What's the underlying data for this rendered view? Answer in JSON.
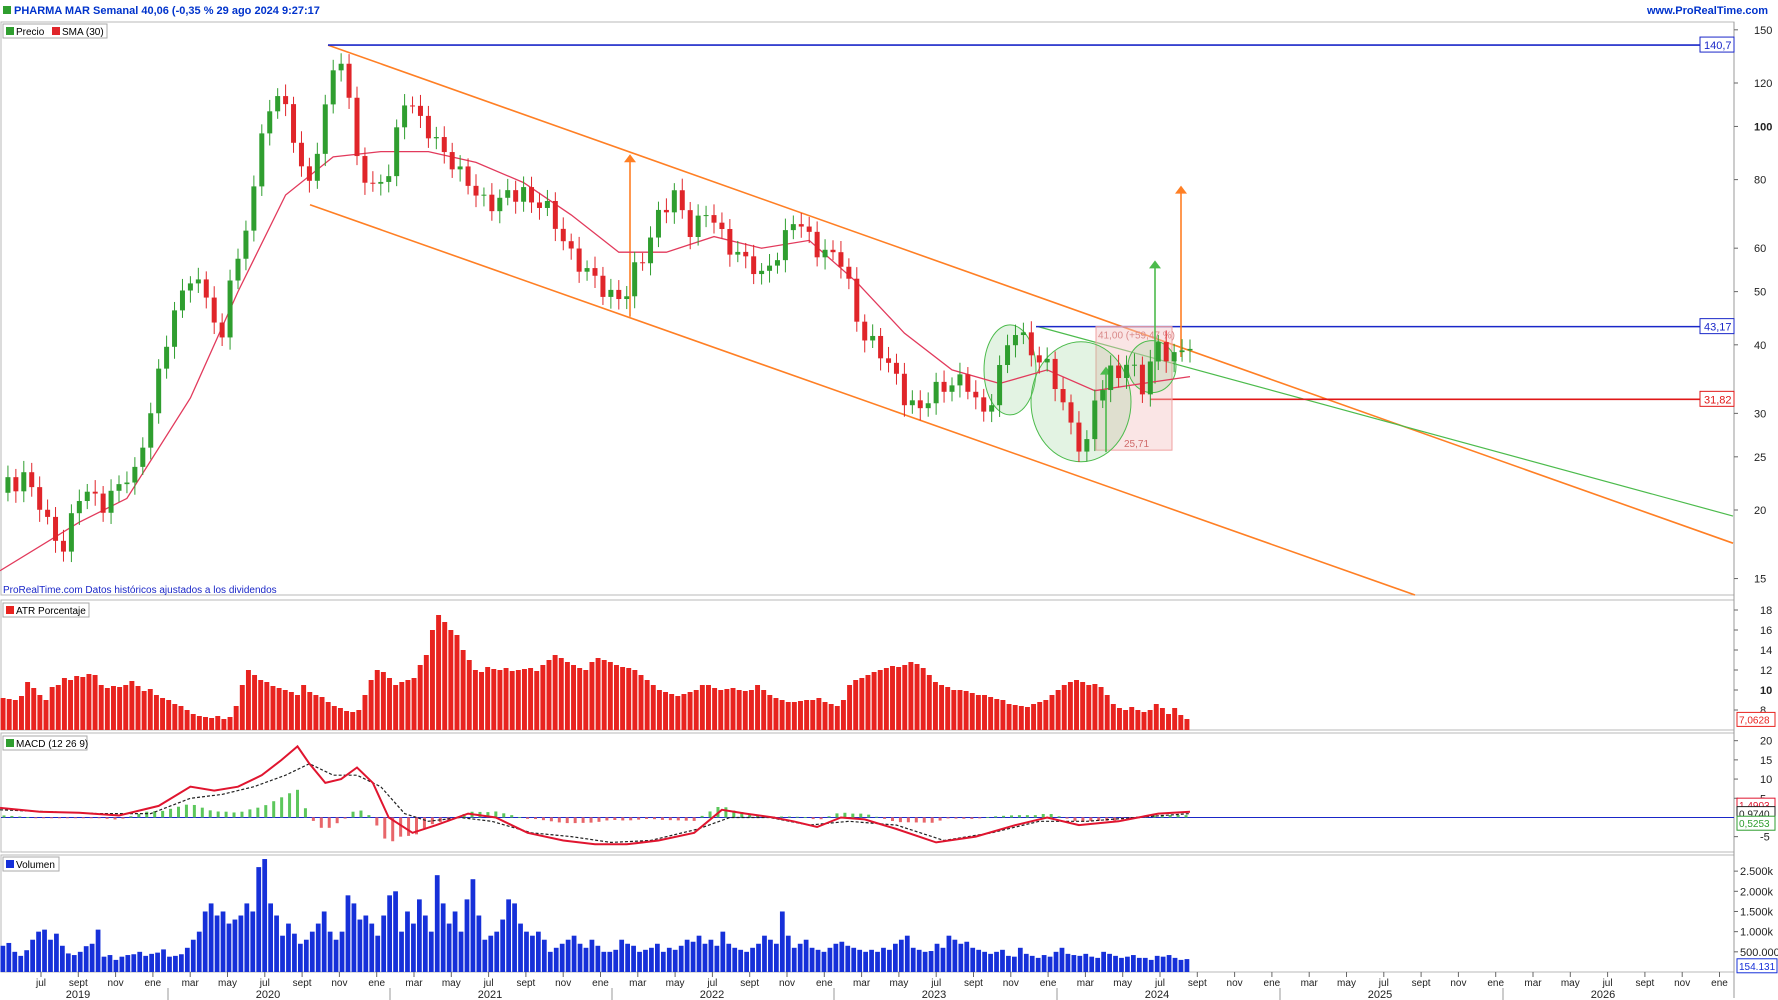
{
  "header": {
    "title": "PHARMA MAR Semanal 40,06 (-0,35 % 29 ago 2024 9:27:17",
    "brand": "www.ProRealTime.com"
  },
  "colors": {
    "up": "#2f9e2f",
    "down": "#e0252a",
    "sma": "#e23a5c",
    "channel": "#ff7f24",
    "blue_line": "#1a27c8",
    "red_line": "#e01818",
    "green_line": "#4cbb4c",
    "atr": "#e8231f",
    "macd": "#e0152f",
    "signal": "#222222",
    "volume": "#1630d9"
  },
  "chart_data": [
    {
      "type": "line",
      "panel": "price",
      "scale": "log",
      "ylim": [
        14,
        155
      ],
      "y_ticks": [
        "15",
        "20",
        "25",
        "30",
        "40",
        "50",
        "60",
        "80",
        "100",
        "120",
        "150"
      ],
      "legend": [
        "Precio",
        "SMA (30)"
      ],
      "footnote": "ProRealTime.com Datos históricos ajustados a los dividendos",
      "x_axis": {
        "months": [
          "jul",
          "sept",
          "nov",
          "ene",
          "mar",
          "may",
          "jul",
          "sept",
          "nov",
          "ene",
          "mar",
          "may",
          "jul",
          "sept",
          "nov",
          "ene",
          "mar",
          "may",
          "jul",
          "sept",
          "nov",
          "ene",
          "mar",
          "may",
          "jul",
          "sept",
          "nov",
          "ene",
          "mar",
          "may",
          "jul",
          "sept",
          "nov",
          "ene",
          "mar",
          "may",
          "jul",
          "sept",
          "nov",
          "ene",
          "mar",
          "may",
          "jul",
          "sept",
          "nov",
          "ene"
        ],
        "years": [
          "2019",
          "2020",
          "2021",
          "2022",
          "2023",
          "2024",
          "2025",
          "2026"
        ]
      },
      "price_series": [
        {
          "t": 0,
          "v": 21.5
        },
        {
          "t": 3,
          "v": 23.5
        },
        {
          "t": 6,
          "v": 18.5
        },
        {
          "t": 8,
          "v": 17.5
        },
        {
          "t": 10,
          "v": 21
        },
        {
          "t": 13,
          "v": 21
        },
        {
          "t": 17,
          "v": 23
        },
        {
          "t": 20,
          "v": 35
        },
        {
          "t": 22,
          "v": 45
        },
        {
          "t": 24,
          "v": 55
        },
        {
          "t": 26,
          "v": 48
        },
        {
          "t": 28,
          "v": 40
        },
        {
          "t": 29,
          "v": 55
        },
        {
          "t": 31,
          "v": 62
        },
        {
          "t": 33,
          "v": 95
        },
        {
          "t": 35,
          "v": 120
        },
        {
          "t": 37,
          "v": 92
        },
        {
          "t": 39,
          "v": 78
        },
        {
          "t": 41,
          "v": 110
        },
        {
          "t": 43,
          "v": 132
        },
        {
          "t": 45,
          "v": 90
        },
        {
          "t": 47,
          "v": 75
        },
        {
          "t": 49,
          "v": 82
        },
        {
          "t": 51,
          "v": 115
        },
        {
          "t": 53,
          "v": 100
        },
        {
          "t": 56,
          "v": 92
        },
        {
          "t": 58,
          "v": 80
        },
        {
          "t": 60,
          "v": 76
        },
        {
          "t": 63,
          "v": 72
        },
        {
          "t": 66,
          "v": 77
        },
        {
          "t": 68,
          "v": 72
        },
        {
          "t": 71,
          "v": 63
        },
        {
          "t": 74,
          "v": 53
        },
        {
          "t": 77,
          "v": 50
        },
        {
          "t": 79,
          "v": 49
        },
        {
          "t": 81,
          "v": 58
        },
        {
          "t": 83,
          "v": 70
        },
        {
          "t": 85,
          "v": 73
        },
        {
          "t": 87,
          "v": 66
        },
        {
          "t": 89,
          "v": 70
        },
        {
          "t": 91,
          "v": 62
        },
        {
          "t": 93,
          "v": 60
        },
        {
          "t": 96,
          "v": 52
        },
        {
          "t": 98,
          "v": 60
        },
        {
          "t": 100,
          "v": 67
        },
        {
          "t": 102,
          "v": 62
        },
        {
          "t": 104,
          "v": 60
        },
        {
          "t": 106,
          "v": 56
        },
        {
          "t": 108,
          "v": 45
        },
        {
          "t": 111,
          "v": 38
        },
        {
          "t": 114,
          "v": 33
        },
        {
          "t": 116,
          "v": 30
        },
        {
          "t": 118,
          "v": 33
        },
        {
          "t": 120,
          "v": 35
        },
        {
          "t": 122,
          "v": 33
        },
        {
          "t": 124,
          "v": 30
        },
        {
          "t": 126,
          "v": 36
        },
        {
          "t": 128,
          "v": 42
        },
        {
          "t": 130,
          "v": 40
        },
        {
          "t": 132,
          "v": 36
        },
        {
          "t": 134,
          "v": 31
        },
        {
          "t": 136,
          "v": 27
        },
        {
          "t": 137,
          "v": 26
        },
        {
          "t": 138,
          "v": 31
        },
        {
          "t": 140,
          "v": 36
        },
        {
          "t": 142,
          "v": 37
        },
        {
          "t": 144,
          "v": 33
        },
        {
          "t": 146,
          "v": 41
        },
        {
          "t": 148,
          "v": 37
        },
        {
          "t": 150,
          "v": 40.06
        }
      ],
      "sma_series": [
        {
          "t": 0,
          "v": 15.5
        },
        {
          "t": 10,
          "v": 19
        },
        {
          "t": 16,
          "v": 21
        },
        {
          "t": 24,
          "v": 32
        },
        {
          "t": 30,
          "v": 50
        },
        {
          "t": 36,
          "v": 75
        },
        {
          "t": 42,
          "v": 88
        },
        {
          "t": 48,
          "v": 90
        },
        {
          "t": 54,
          "v": 90
        },
        {
          "t": 60,
          "v": 86
        },
        {
          "t": 66,
          "v": 79
        },
        {
          "t": 72,
          "v": 69
        },
        {
          "t": 78,
          "v": 59
        },
        {
          "t": 84,
          "v": 59
        },
        {
          "t": 90,
          "v": 63
        },
        {
          "t": 96,
          "v": 60
        },
        {
          "t": 102,
          "v": 62
        },
        {
          "t": 108,
          "v": 52
        },
        {
          "t": 114,
          "v": 42
        },
        {
          "t": 120,
          "v": 36
        },
        {
          "t": 126,
          "v": 34
        },
        {
          "t": 132,
          "v": 36
        },
        {
          "t": 138,
          "v": 33
        },
        {
          "t": 144,
          "v": 34
        },
        {
          "t": 150,
          "v": 35
        }
      ],
      "levels": [
        {
          "label": "140,7",
          "value": 140.7,
          "color": "blue"
        },
        {
          "label": "43,17",
          "value": 43.17,
          "color": "blue"
        },
        {
          "label": "31,82",
          "value": 31.82,
          "color": "red"
        }
      ],
      "annotations": {
        "fib_box_top": "41,00 (+59,47 %)",
        "fib_box_low": "25,71"
      }
    },
    {
      "type": "bar",
      "panel": "atr",
      "legend": [
        "ATR Porcentaje"
      ],
      "ylim": [
        6,
        19
      ],
      "y_ticks": [
        "8",
        "10",
        "12",
        "14",
        "16",
        "18"
      ],
      "last_value": "7,0628",
      "values": [
        9.2,
        9.1,
        9.0,
        9.4,
        10.8,
        10.2,
        9.5,
        9.0,
        10.3,
        10.5,
        11.2,
        11.0,
        11.4,
        11.3,
        11.6,
        11.5,
        10.5,
        10.2,
        10.4,
        10.3,
        10.5,
        10.9,
        10.4,
        9.9,
        10.1,
        9.5,
        9.2,
        9.0,
        8.6,
        8.4,
        8.0,
        7.6,
        7.4,
        7.3,
        7.2,
        7.4,
        7.1,
        7.3,
        8.4,
        10.5,
        12.0,
        11.5,
        11.0,
        10.8,
        10.4,
        10.2,
        10.0,
        9.8,
        9.5,
        10.5,
        9.8,
        9.5,
        9.3,
        8.8,
        8.4,
        8.2,
        7.9,
        7.8,
        8.0,
        9.5,
        11.0,
        12.0,
        11.8,
        11.2,
        10.5,
        10.8,
        11.0,
        11.2,
        12.5,
        13.5,
        16.0,
        17.5,
        16.8,
        16.0,
        15.5,
        14.0,
        13.0,
        12.0,
        11.8,
        12.3,
        12.1,
        12.0,
        12.2,
        11.9,
        12.0,
        12.1,
        12.2,
        11.9,
        12.5,
        13.0,
        13.5,
        13.2,
        12.8,
        12.5,
        12.2,
        12.0,
        12.8,
        13.2,
        13.0,
        12.8,
        12.5,
        12.3,
        12.2,
        12.0,
        11.5,
        11.0,
        10.5,
        10.0,
        9.8,
        9.6,
        9.4,
        9.6,
        9.8,
        10.0,
        10.5,
        10.5,
        10.2,
        10.0,
        10.1,
        10.2,
        10.0,
        9.9,
        10.0,
        10.5,
        10.0,
        9.5,
        9.2,
        9.0,
        8.8,
        8.8,
        8.9,
        9.0,
        9.0,
        9.2,
        8.8,
        8.6,
        8.4,
        9.0,
        10.5,
        11.0,
        11.2,
        11.5,
        11.8,
        12.0,
        12.2,
        12.4,
        12.3,
        12.5,
        12.8,
        12.6,
        12.2,
        11.5,
        10.8,
        10.5,
        10.3,
        10.0,
        10.0,
        9.9,
        9.7,
        9.5,
        9.5,
        9.3,
        9.1,
        9.0,
        8.6,
        8.5,
        8.4,
        8.3,
        8.6,
        8.8,
        9.0,
        9.5,
        10.0,
        10.5,
        10.8,
        11.0,
        10.8,
        10.5,
        10.6,
        10.3,
        9.5,
        8.6,
        8.2,
        8.0,
        8.3,
        8.0,
        7.8,
        8.0,
        8.6,
        8.2,
        7.6,
        8.2,
        7.5,
        7.1
      ]
    },
    {
      "type": "line",
      "panel": "macd",
      "legend": [
        "MACD (12 26 9)"
      ],
      "ylim": [
        -9,
        22
      ],
      "y_ticks": [
        "-5",
        "5",
        "10",
        "15",
        "20"
      ],
      "value_labels": [
        "1,4903",
        "0,9740",
        "0,5253"
      ],
      "macd": [
        {
          "t": 0,
          "v": 2.5
        },
        {
          "t": 10,
          "v": 1.5
        },
        {
          "t": 20,
          "v": 1.2
        },
        {
          "t": 30,
          "v": 0.5
        },
        {
          "t": 40,
          "v": 3
        },
        {
          "t": 48,
          "v": 8
        },
        {
          "t": 54,
          "v": 7
        },
        {
          "t": 60,
          "v": 8
        },
        {
          "t": 66,
          "v": 11
        },
        {
          "t": 71,
          "v": 15
        },
        {
          "t": 75,
          "v": 18.5
        },
        {
          "t": 78,
          "v": 14
        },
        {
          "t": 82,
          "v": 9
        },
        {
          "t": 86,
          "v": 10
        },
        {
          "t": 90,
          "v": 13
        },
        {
          "t": 94,
          "v": 9
        },
        {
          "t": 98,
          "v": 0
        },
        {
          "t": 104,
          "v": -4
        },
        {
          "t": 110,
          "v": -2
        },
        {
          "t": 118,
          "v": 1
        },
        {
          "t": 125,
          "v": 0
        },
        {
          "t": 133,
          "v": -4
        },
        {
          "t": 142,
          "v": -6
        },
        {
          "t": 150,
          "v": -7
        },
        {
          "t": 158,
          "v": -7
        },
        {
          "t": 166,
          "v": -6
        },
        {
          "t": 175,
          "v": -4
        },
        {
          "t": 182,
          "v": 2
        },
        {
          "t": 188,
          "v": 1
        },
        {
          "t": 195,
          "v": 0
        },
        {
          "t": 200,
          "v": -1
        },
        {
          "t": 206,
          "v": -2.5
        },
        {
          "t": 212,
          "v": 0
        },
        {
          "t": 218,
          "v": -0.5
        },
        {
          "t": 226,
          "v": -3
        },
        {
          "t": 236,
          "v": -6.5
        },
        {
          "t": 246,
          "v": -5
        },
        {
          "t": 256,
          "v": -2
        },
        {
          "t": 264,
          "v": 0
        },
        {
          "t": 272,
          "v": -2
        },
        {
          "t": 282,
          "v": -1
        },
        {
          "t": 292,
          "v": 1
        },
        {
          "t": 300,
          "v": 1.5
        }
      ],
      "signal": [
        {
          "t": 0,
          "v": 2
        },
        {
          "t": 12,
          "v": 1.5
        },
        {
          "t": 25,
          "v": 1
        },
        {
          "t": 38,
          "v": 1
        },
        {
          "t": 48,
          "v": 5
        },
        {
          "t": 56,
          "v": 6
        },
        {
          "t": 64,
          "v": 8
        },
        {
          "t": 72,
          "v": 11
        },
        {
          "t": 78,
          "v": 14
        },
        {
          "t": 84,
          "v": 11
        },
        {
          "t": 90,
          "v": 11
        },
        {
          "t": 96,
          "v": 8
        },
        {
          "t": 102,
          "v": 1
        },
        {
          "t": 108,
          "v": -1
        },
        {
          "t": 116,
          "v": 0
        },
        {
          "t": 124,
          "v": -1
        },
        {
          "t": 134,
          "v": -4
        },
        {
          "t": 144,
          "v": -5
        },
        {
          "t": 154,
          "v": -6.5
        },
        {
          "t": 164,
          "v": -6
        },
        {
          "t": 176,
          "v": -3
        },
        {
          "t": 184,
          "v": 0
        },
        {
          "t": 194,
          "v": 0
        },
        {
          "t": 204,
          "v": -2
        },
        {
          "t": 214,
          "v": -1
        },
        {
          "t": 226,
          "v": -2
        },
        {
          "t": 238,
          "v": -6
        },
        {
          "t": 250,
          "v": -4
        },
        {
          "t": 262,
          "v": -1
        },
        {
          "t": 274,
          "v": -1
        },
        {
          "t": 286,
          "v": 0
        },
        {
          "t": 300,
          "v": 1
        }
      ]
    },
    {
      "type": "bar",
      "panel": "volume",
      "legend": [
        "Volumen"
      ],
      "ylim": [
        0,
        2900
      ],
      "y_ticks": [
        "500.000",
        "1.000k",
        "1.500k",
        "2.000k",
        "2.500k"
      ],
      "values": [
        650,
        720,
        500,
        400,
        540,
        800,
        1000,
        1050,
        800,
        950,
        650,
        460,
        420,
        500,
        640,
        700,
        1050,
        380,
        420,
        300,
        380,
        420,
        440,
        500,
        400,
        450,
        480,
        560,
        380,
        400,
        440,
        600,
        800,
        1000,
        1500,
        1700,
        1400,
        1500,
        1200,
        1300,
        1400,
        1700,
        1500,
        2600,
        2800,
        1700,
        1400,
        900,
        1200,
        950,
        700,
        800,
        1000,
        1200,
        1500,
        1000,
        800,
        1000,
        1900,
        1700,
        1300,
        1400,
        1200,
        900,
        1400,
        1900,
        2000,
        1000,
        1500,
        1200,
        1800,
        1400,
        1000,
        2400,
        1700,
        1200,
        1500,
        1000,
        1800,
        2300,
        1400,
        800,
        900,
        1000,
        1300,
        1800,
        1700,
        1200,
        1000,
        900,
        1000,
        800,
        500,
        600,
        700,
        800,
        900,
        700,
        600,
        800,
        650,
        500,
        500,
        550,
        800,
        700,
        650,
        500,
        550,
        600,
        700,
        500,
        600,
        550,
        650,
        800,
        750,
        900,
        700,
        800,
        650,
        1000,
        700,
        600,
        550,
        500,
        600,
        700,
        900,
        800,
        700,
        1500,
        900,
        600,
        700,
        800,
        600,
        550,
        500,
        600,
        700,
        750,
        650,
        600,
        550,
        500,
        550,
        500,
        600,
        550,
        700,
        800,
        900,
        600,
        550,
        500,
        520,
        700,
        600,
        900,
        800,
        700,
        750,
        600,
        550,
        500,
        450,
        500,
        550,
        400,
        380,
        600,
        450,
        400,
        350,
        420,
        380,
        500,
        600,
        450,
        420,
        400,
        450,
        380,
        350,
        500,
        450,
        400,
        350,
        380,
        420,
        350,
        350,
        300,
        400,
        380,
        420,
        350,
        300,
        320
      ]
    }
  ]
}
